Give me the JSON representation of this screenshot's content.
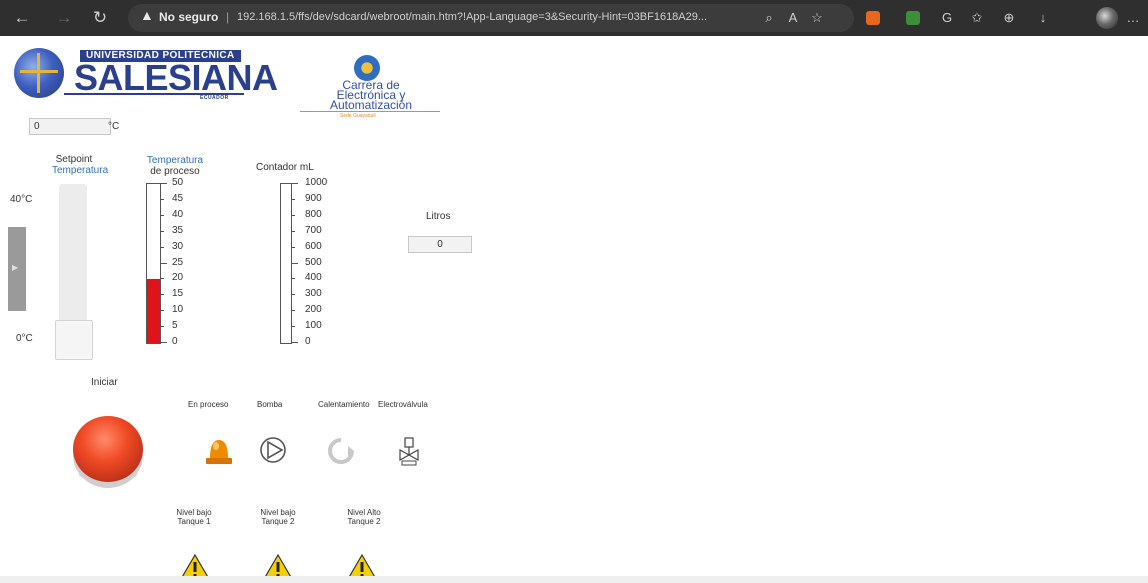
{
  "browser": {
    "security_label": "No seguro",
    "separator": "|",
    "url": "192.168.1.5/ffs/dev/sdcard/webroot/main.htm?!App-Language=3&Security-Hint=03BF1618A29...",
    "icons": [
      "back-icon",
      "forward-icon",
      "refresh-icon",
      "warning-icon",
      "search-icon",
      "read-aloud-icon",
      "add-favorite-icon",
      "extension-icons",
      "favorites-icon",
      "collections-icon",
      "downloads-icon",
      "profile-avatar",
      "more-icon"
    ]
  },
  "logos": {
    "ups_top": "UNIVERSIDAD POLITÉCNICA",
    "ups_main": "SALESIANA",
    "ups_sub": "ECUADOR",
    "career_line1": "Carrera de",
    "career_line2": "Electrónica y",
    "career_line3": "Automatización",
    "career_sub": "Sede Guayaquil"
  },
  "temperature_input": {
    "value": "0",
    "unit": "°C"
  },
  "setpoint": {
    "label_line1": "Setpoint",
    "label_line2": "Temperatura",
    "max_label": "40°C",
    "min_label": "0°C",
    "level_fraction": 0.0
  },
  "process_temp": {
    "label_line1": "Temperatura",
    "label_line2": "de proceso",
    "ticks": [
      "50",
      "45",
      "40",
      "35",
      "30",
      "25",
      "20",
      "15",
      "10",
      "5",
      "0"
    ],
    "value": 20,
    "max": 50
  },
  "counter": {
    "label": "Contador mL",
    "ticks": [
      "1000",
      "900",
      "800",
      "700",
      "600",
      "500",
      "400",
      "300",
      "200",
      "100",
      "0"
    ],
    "value": 0
  },
  "liters": {
    "label": "Litros",
    "value": "0"
  },
  "start": {
    "label": "Iniciar"
  },
  "indicators": {
    "in_process": "En proceso",
    "pump": "Bomba",
    "heating": "Calentamiento",
    "valve": "Electroválvula"
  },
  "levels": {
    "low_tank1_line1": "Nivel bajo",
    "low_tank1_line2": "Tanque 1",
    "low_tank2_line1": "Nivel bajo",
    "low_tank2_line2": "Tanque 2",
    "high_tank2_line1": "Nivel Alto",
    "high_tank2_line2": "Tanque 2"
  },
  "colors": {
    "fill": "#e0121a",
    "beacon": "#f08a00",
    "warning": "#f5d000"
  }
}
